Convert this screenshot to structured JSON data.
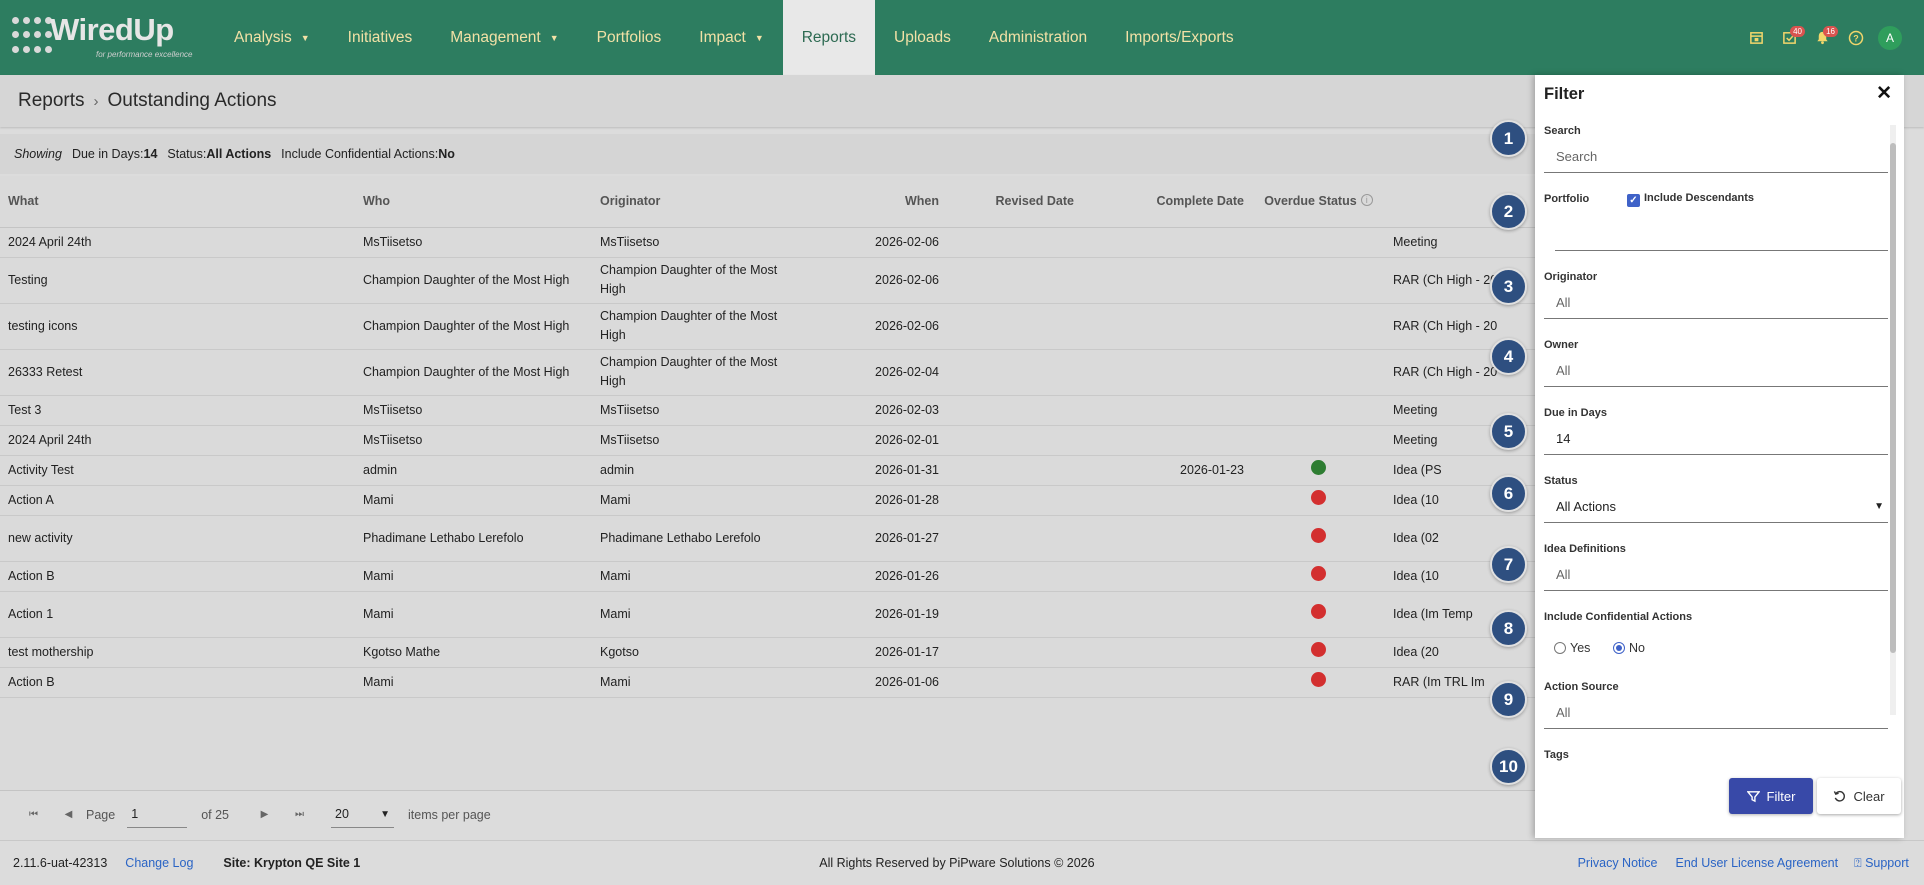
{
  "brand": {
    "name": "WiredUp",
    "tagline": "for performance excellence"
  },
  "nav": {
    "items": [
      {
        "label": "Analysis",
        "dropdown": true
      },
      {
        "label": "Initiatives",
        "dropdown": false
      },
      {
        "label": "Management",
        "dropdown": true
      },
      {
        "label": "Portfolios",
        "dropdown": false
      },
      {
        "label": "Impact",
        "dropdown": true
      },
      {
        "label": "Reports",
        "dropdown": false,
        "active": true
      },
      {
        "label": "Uploads",
        "dropdown": false
      },
      {
        "label": "Administration",
        "dropdown": false
      },
      {
        "label": "Imports/Exports",
        "dropdown": false
      }
    ],
    "icons": {
      "calendar": "calendar-icon",
      "tasks": "task-check-icon",
      "tasks_badge": "40",
      "bell": "bell-icon",
      "bell_badge": "16",
      "help": "help-icon",
      "avatar": "A"
    }
  },
  "breadcrumb": {
    "root": "Reports",
    "current": "Outstanding Actions"
  },
  "showing": {
    "label": "Showing",
    "due_label": "Due in Days:",
    "due_value": "14",
    "status_label": "Status:",
    "status_value": "All Actions",
    "conf_label": "Include Confidential Actions:",
    "conf_value": "No"
  },
  "table": {
    "columns": [
      "What",
      "Who",
      "Originator",
      "When",
      "Revised Date",
      "Complete Date",
      "Overdue Status",
      ""
    ],
    "rows": [
      {
        "what": "2024 April 24th",
        "who": "MsTiisetso",
        "originator": "MsTiisetso",
        "when": "2026-02-06",
        "revised": "",
        "complete": "",
        "status": "",
        "source": "Meeting"
      },
      {
        "what": "Testing",
        "who": "Champion Daughter of the Most High",
        "originator": "Champion Daughter of the Most High",
        "when": "2026-02-06",
        "revised": "",
        "complete": "",
        "status": "",
        "source": "RAR (Ch High - 20"
      },
      {
        "what": "testing icons",
        "who": "Champion Daughter of the Most High",
        "originator": "Champion Daughter of the Most High",
        "when": "2026-02-06",
        "revised": "",
        "complete": "",
        "status": "",
        "source": "RAR (Ch High - 20"
      },
      {
        "what": "26333 Retest",
        "who": "Champion Daughter of the Most High",
        "originator": "Champion Daughter of the Most High",
        "when": "2026-02-04",
        "revised": "",
        "complete": "",
        "status": "",
        "source": "RAR (Ch High - 20"
      },
      {
        "what": "Test 3",
        "who": "MsTiisetso",
        "originator": "MsTiisetso",
        "when": "2026-02-03",
        "revised": "",
        "complete": "",
        "status": "",
        "source": "Meeting"
      },
      {
        "what": "2024 April 24th",
        "who": "MsTiisetso",
        "originator": "MsTiisetso",
        "when": "2026-02-01",
        "revised": "",
        "complete": "",
        "status": "",
        "source": "Meeting"
      },
      {
        "what": "Activity Test",
        "who": "admin",
        "originator": "admin",
        "when": "2026-01-31",
        "revised": "",
        "complete": "2026-01-23",
        "status": "green",
        "source": "Idea (PS"
      },
      {
        "what": "Action A",
        "who": "Mami",
        "originator": "Mami",
        "when": "2026-01-28",
        "revised": "",
        "complete": "",
        "status": "red",
        "source": "Idea (10"
      },
      {
        "what": "new activity",
        "who": "Phadimane Lethabo Lerefolo",
        "originator": "Phadimane Lethabo Lerefolo",
        "when": "2026-01-27",
        "revised": "",
        "complete": "",
        "status": "red",
        "source": "Idea (02"
      },
      {
        "what": "Action B",
        "who": "Mami",
        "originator": "Mami",
        "when": "2026-01-26",
        "revised": "",
        "complete": "",
        "status": "red",
        "source": "Idea (10"
      },
      {
        "what": "Action 1",
        "who": "Mami",
        "originator": "Mami",
        "when": "2026-01-19",
        "revised": "",
        "complete": "",
        "status": "red",
        "source": "Idea (Im Temp"
      },
      {
        "what": "test mothership",
        "who": "Kgotso Mathe",
        "originator": "Kgotso",
        "when": "2026-01-17",
        "revised": "",
        "complete": "",
        "status": "red",
        "source": "Idea (20"
      },
      {
        "what": "Action B",
        "who": "Mami",
        "originator": "Mami",
        "when": "2026-01-06",
        "revised": "",
        "complete": "",
        "status": "red",
        "source": "RAR (Im TRL Im"
      }
    ]
  },
  "pager": {
    "page_label": "Page",
    "page": "1",
    "of": "of 25",
    "per_page": "20",
    "per_page_label": "items per page"
  },
  "footer": {
    "version": "2.11.6-uat-42313",
    "changelog": "Change Log",
    "site": "Site: Krypton QE Site 1",
    "rights": "All Rights Reserved by PiPware Solutions © 2026",
    "privacy": "Privacy Notice",
    "eula": "End User License Agreement",
    "support": "Support"
  },
  "steps": [
    "1",
    "2",
    "3",
    "4",
    "5",
    "6",
    "7",
    "8",
    "9",
    "10"
  ],
  "filter": {
    "title": "Filter",
    "search_label": "Search",
    "search_placeholder": "Search",
    "portfolio_label": "Portfolio",
    "include_desc": "Include Descendants",
    "originator_label": "Originator",
    "originator_value": "All",
    "owner_label": "Owner",
    "owner_value": "All",
    "due_label": "Due in Days",
    "due_value": "14",
    "status_label": "Status",
    "status_value": "All Actions",
    "idea_label": "Idea Definitions",
    "idea_value": "All",
    "conf_label": "Include Confidential Actions",
    "yes": "Yes",
    "no": "No",
    "source_label": "Action Source",
    "source_value": "All",
    "tags_label": "Tags",
    "filter_button": "Filter",
    "clear_button": "Clear"
  },
  "colors": {
    "nav_bg": "#2d7d60",
    "nav_text": "#f2e1a6",
    "accent": "#3849a8",
    "status_red": "#d32f2f",
    "status_green": "#2e7d32",
    "step_marker": "#2e4f80"
  }
}
